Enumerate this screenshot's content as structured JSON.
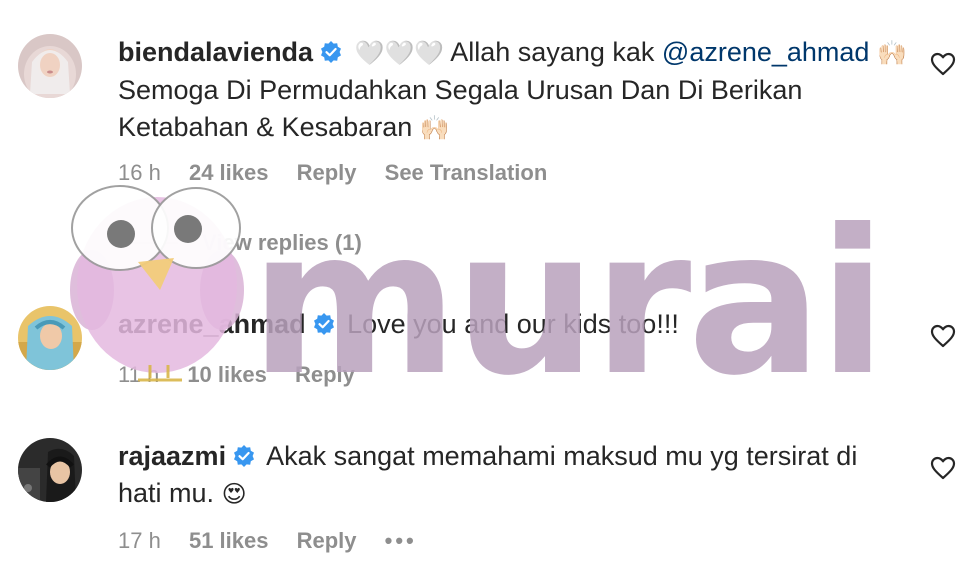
{
  "comments": [
    {
      "username": "biendalavienda",
      "hearts": "🤍🤍🤍",
      "text_a": "Allah sayang kak",
      "mention": "@azrene_ahmad",
      "hands": "🙌🏻",
      "text_b": "Semoga Di Permudahkan Segala Urusan Dan Di Berikan Ketabahan & Kesabaran",
      "time": "16 h",
      "likes": "24 likes",
      "reply": "Reply",
      "translate": "See Translation",
      "view_replies": "View replies (1)"
    },
    {
      "username": "azrene_ahmad",
      "text": "Love you and our kids too!!!",
      "time": "11 h",
      "likes": "10 likes",
      "reply": "Reply"
    },
    {
      "username": "rajaazmi",
      "text": "Akak sangat memahami maksud mu yg tersirat di hati mu.",
      "emoji": "😍",
      "time": "17 h",
      "likes": "51 likes",
      "reply": "Reply",
      "more": "•••"
    }
  ],
  "watermark": {
    "text": "murai",
    "color": "#b9a2bd"
  },
  "icons": {
    "verified": "verified-badge-icon",
    "like": "heart-outline-icon",
    "more": "more-options-icon"
  },
  "colors": {
    "verified": "#3897f0",
    "mention": "#00376b",
    "meta": "#8e8e8e"
  }
}
